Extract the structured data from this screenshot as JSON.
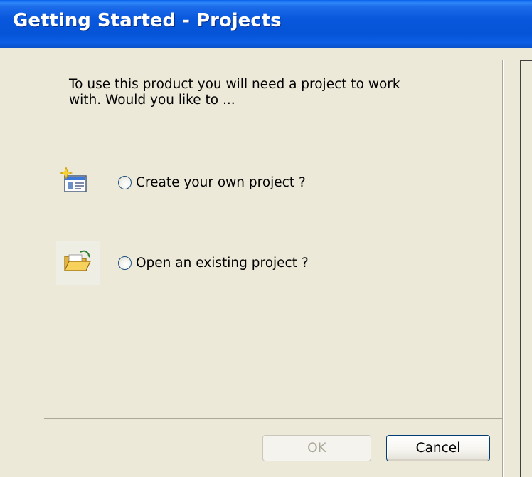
{
  "window": {
    "title": "Getting Started - Projects"
  },
  "main": {
    "intro_text": "To use this product you will need a project to work\nwith.  Would you like to ...",
    "options": [
      {
        "icon": "new-project-icon",
        "label": "Create your own project ?",
        "selected": false
      },
      {
        "icon": "open-folder-icon",
        "label": "Open an existing project ?",
        "selected": false
      }
    ]
  },
  "buttons": {
    "ok_label": "OK",
    "ok_enabled": false,
    "cancel_label": "Cancel"
  },
  "colors": {
    "titlebar": "#0554D8",
    "dialog_background": "#ECE9D8",
    "disabled_text": "#ACA899",
    "radio_border": "#1C5180"
  }
}
